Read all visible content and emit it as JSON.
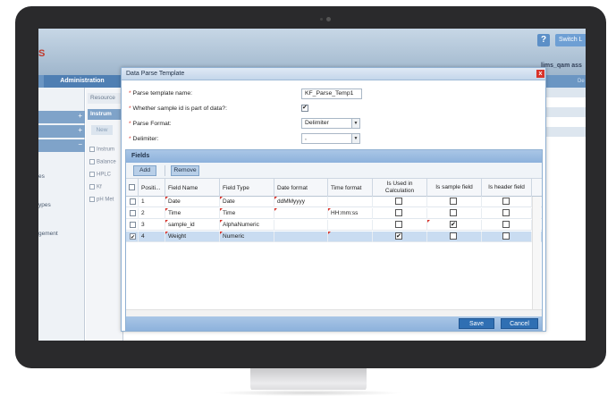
{
  "app": {
    "logo": "S",
    "help_label": "?",
    "switch_label": "Switch L",
    "user": "lims_qam ass",
    "nav_tab": "Administration",
    "nav_right": "De"
  },
  "left_panel": {
    "items": [
      "es",
      "ypes",
      "gement"
    ]
  },
  "mid_panel": {
    "resource_tab": "Resource",
    "instrum_tab": "Instrum",
    "new_label": "New",
    "items": [
      "Instrum",
      "Balance",
      "HPLC",
      "Kf",
      "pH Met"
    ]
  },
  "dialog": {
    "title": "Data Parse Template",
    "close_label": "x",
    "form": {
      "template_name_label": "Parse template name:",
      "template_name_value": "KF_Parse_Temp1",
      "sample_id_label": "Whether sample id is part of data?:",
      "parse_format_label": "Parse Format:",
      "parse_format_value": "Delimiter",
      "delimiter_label": "Delimiter:",
      "delimiter_value": ","
    },
    "fields": {
      "title": "Fields",
      "add_label": "Add",
      "remove_label": "Remove",
      "columns": {
        "position": "Positi...",
        "field_name": "Field Name",
        "field_type": "Field Type",
        "date_format": "Date format",
        "time_format": "Time format",
        "used_in_calc": "Is Used in Calculation",
        "sample_field": "Is sample field",
        "header_field": "Is header field"
      },
      "rows": [
        {
          "position": "1",
          "field_name": "Date",
          "field_type": "Date",
          "date_format": "ddMMyyyy",
          "time_format": ""
        },
        {
          "position": "2",
          "field_name": "Time",
          "field_type": "Time",
          "date_format": "",
          "time_format": "HH:mm:ss"
        },
        {
          "position": "3",
          "field_name": "sample_id",
          "field_type": "AlphaNumeric",
          "date_format": "",
          "time_format": ""
        },
        {
          "position": "4",
          "field_name": "Weight",
          "field_type": "Numeric",
          "date_format": "",
          "time_format": ""
        }
      ]
    },
    "save_label": "Save",
    "cancel_label": "Cancel"
  }
}
